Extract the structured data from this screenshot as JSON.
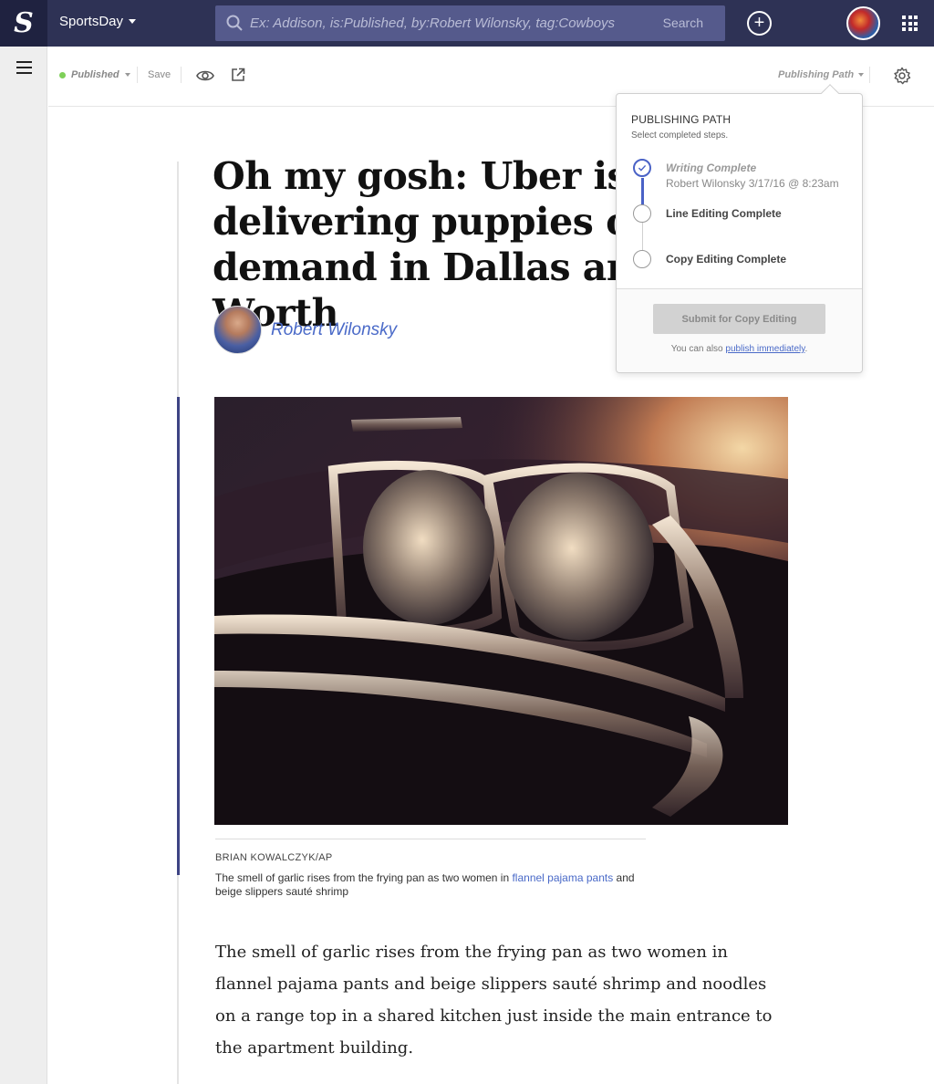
{
  "topnav": {
    "logo": "S",
    "brand": "SportsDay",
    "search": {
      "placeholder": "Ex: Addison, is:Published, by:Robert Wilonsky, tag:Cowboys",
      "button": "Search"
    },
    "add_icon": "plus-circle-icon",
    "apps_icon": "grid-icon"
  },
  "toolbar": {
    "status": "Published",
    "status_color": "#7ed058",
    "save": "Save",
    "publishing_path": "Publishing Path"
  },
  "article": {
    "headline": "Oh my gosh: Uber is delivering puppies on demand in Dallas and Forth Worth",
    "author": "Robert Wilonsky",
    "photo_credit": "BRIAN KOWALCZYK/AP",
    "caption_before": "The smell of garlic rises from the frying pan as two women in ",
    "caption_link": "flannel pajama pants",
    "caption_after": " and beige slippers sauté shrimp",
    "body": "The smell of garlic rises from the frying pan as two women in flannel pajama pants and beige slippers sauté shrimp and noodles on a range top in a shared kitchen just inside the main entrance to the apartment building."
  },
  "publishing_path": {
    "title": "PUBLISHING PATH",
    "subtitle": "Select completed steps.",
    "steps": [
      {
        "label": "Writing Complete",
        "meta": "Robert Wilonsky 3/17/16 @ 8:23am",
        "done": true
      },
      {
        "label": "Line Editing Complete",
        "done": false
      },
      {
        "label": "Copy Editing Complete",
        "done": false
      }
    ],
    "submit": "Submit for Copy Editing",
    "note_before": "You can also ",
    "note_link": "publish immediately",
    "note_after": ".",
    "accent": "#4a62c6"
  }
}
